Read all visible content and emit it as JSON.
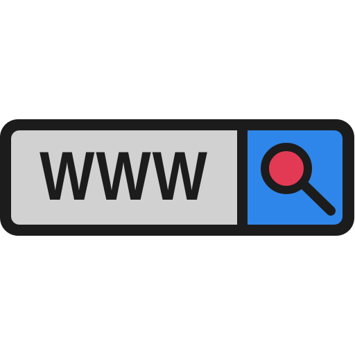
{
  "address_bar": {
    "url_text": "WWW"
  },
  "search_button": {
    "icon": "search-icon"
  },
  "colors": {
    "outline": "#1c1c1c",
    "field_background": "#d1d1d1",
    "button_background": "#2f86ea",
    "lens_fill": "#e23a55"
  }
}
